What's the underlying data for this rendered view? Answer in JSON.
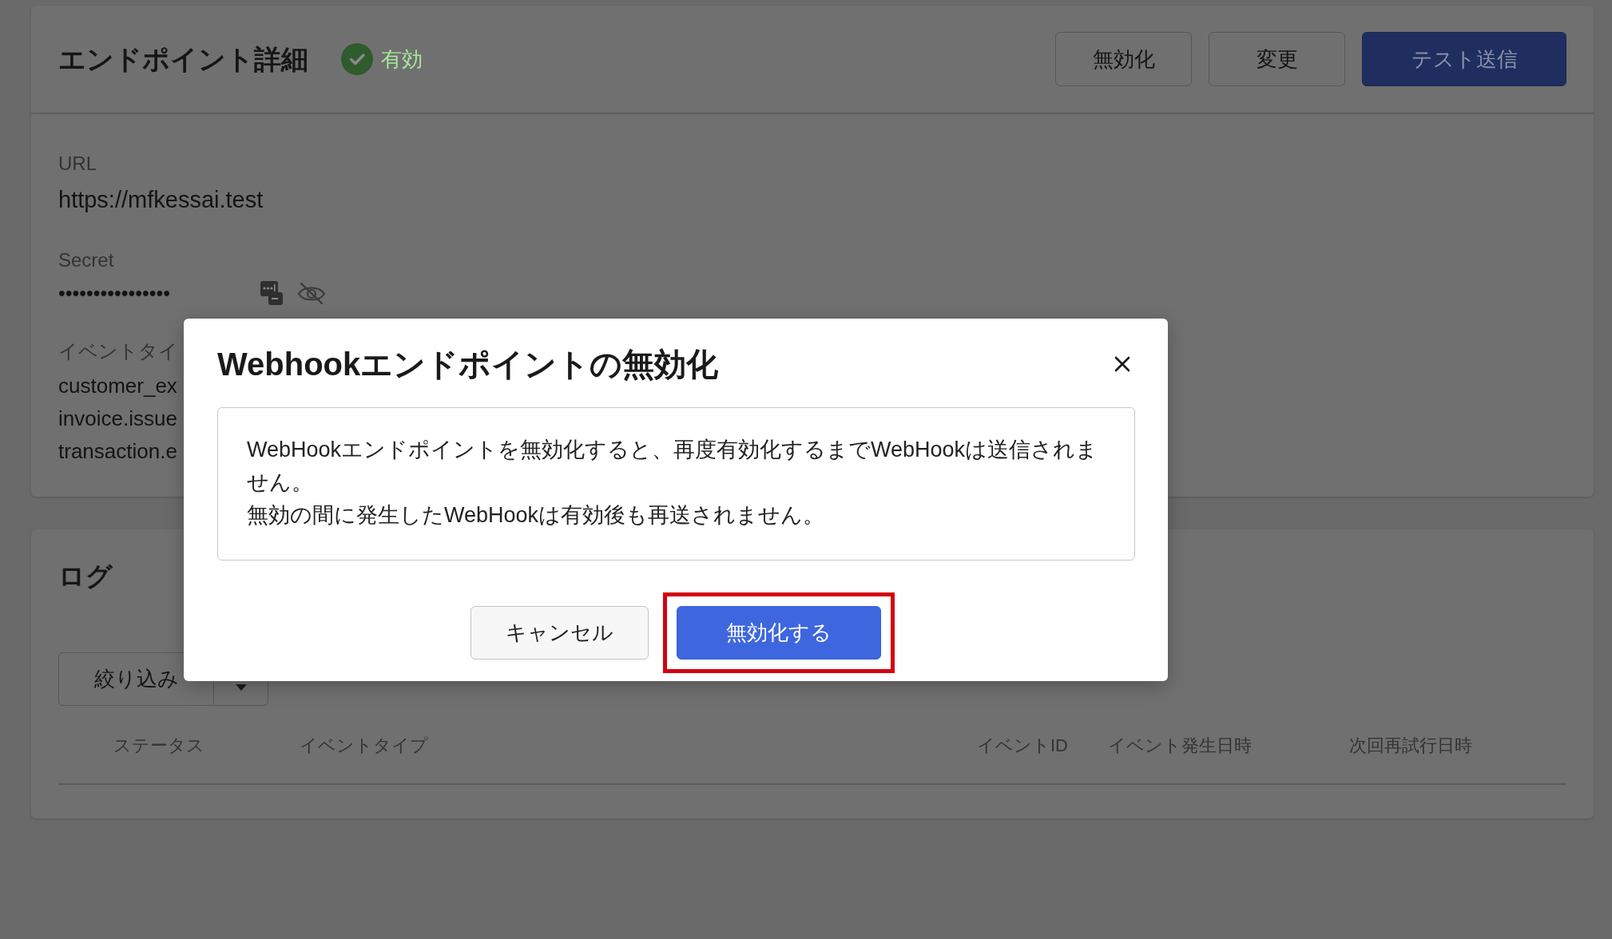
{
  "endpoint_detail": {
    "title": "エンドポイント詳細",
    "status": {
      "label": "有効",
      "active": true
    },
    "actions": [
      {
        "label": "無効化",
        "kind": "secondary"
      },
      {
        "label": "変更",
        "kind": "secondary"
      },
      {
        "label": "テスト送信",
        "kind": "primary"
      }
    ],
    "fields": [
      {
        "kind": "text",
        "label": "URL",
        "value": "https://mfkessai.test"
      },
      {
        "kind": "secret",
        "label": "Secret",
        "value": "••••••••••••••••"
      },
      {
        "kind": "list",
        "label": "イベントタイ",
        "values": [
          "customer_ex",
          "invoice.issue",
          "transaction.e"
        ]
      }
    ]
  },
  "log": {
    "title": "ログ",
    "filter": {
      "label": "絞り込み"
    },
    "table": {
      "columns": [
        "ステータス",
        "イベントタイプ",
        "イベントID",
        "イベント発生日時",
        "次回再試行日時"
      ]
    }
  },
  "dialog": {
    "title": "Webhookエンドポイントの無効化",
    "message": [
      "WebHookエンドポイントを無効化すると、再度有効化するまでWebHookは送信されません。",
      "無効の間に発生したWebHookは有効後も再送されません。"
    ],
    "buttons": [
      {
        "label": "キャンセル",
        "kind": "secondary",
        "highlighted": false
      },
      {
        "label": "無効化する",
        "kind": "primary",
        "highlighted": true
      }
    ]
  }
}
